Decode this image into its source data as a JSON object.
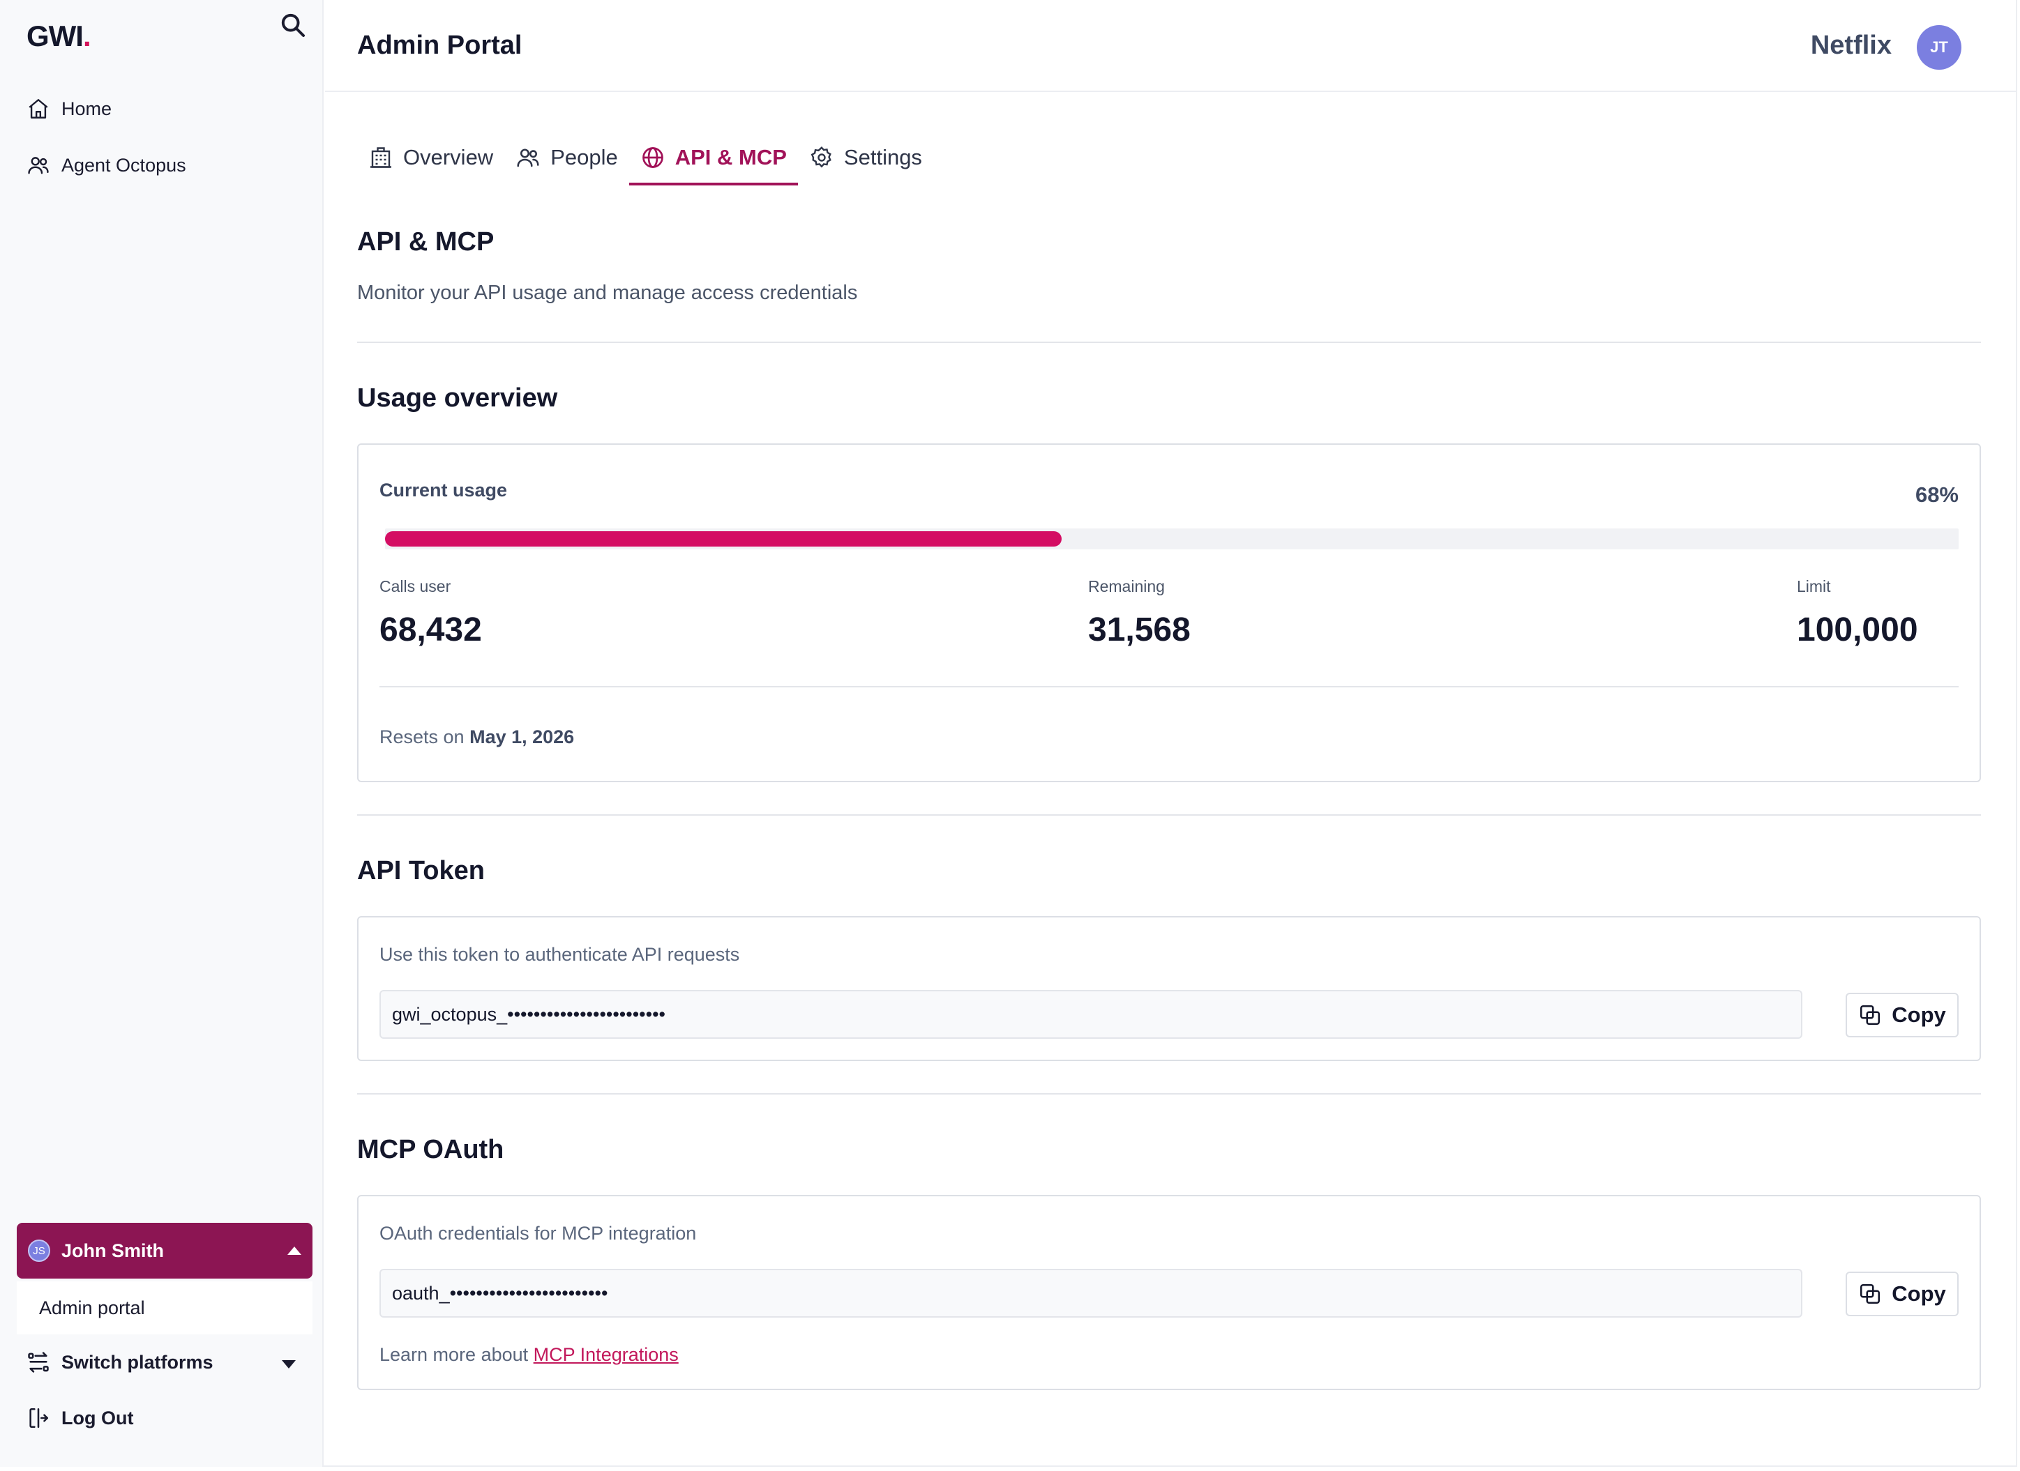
{
  "sidebar": {
    "logo_text": "GWI",
    "logo_dot": ".",
    "search_icon": "search-icon",
    "nav": [
      {
        "label": "Home",
        "icon": "home-icon"
      },
      {
        "label": "Agent Octopus",
        "icon": "users-icon"
      }
    ],
    "user": {
      "initials": "JS",
      "name": "John Smith"
    },
    "submenu_item": "Admin portal",
    "switch_platforms": "Switch platforms",
    "logout": "Log Out"
  },
  "header": {
    "title": "Admin Portal",
    "org": "Netflix",
    "avatar_initials": "JT"
  },
  "tabs": [
    {
      "label": "Overview",
      "icon": "building-icon",
      "active": false
    },
    {
      "label": "People",
      "icon": "people-icon",
      "active": false
    },
    {
      "label": "API & MCP",
      "icon": "globe-icon",
      "active": true
    },
    {
      "label": "Settings",
      "icon": "gear-icon",
      "active": false
    }
  ],
  "section": {
    "title": "API & MCP",
    "subtitle": "Monitor your API usage and manage access credentials"
  },
  "usage": {
    "heading": "Usage overview",
    "label": "Current usage",
    "percent_text": "68%",
    "percent_value": 0.43,
    "stats": [
      {
        "label": "Calls user",
        "value": "68,432"
      },
      {
        "label": "Remaining",
        "value": "31,568"
      },
      {
        "label": "Limit",
        "value": "100,000"
      }
    ],
    "resets_prefix": "Resets on",
    "resets_date": "May 1, 2026"
  },
  "api_token": {
    "heading": "API Token",
    "hint": "Use this token to authenticate API requests",
    "value": "gwi_octopus_••••••••••••••••••••••••",
    "copy_label": "Copy"
  },
  "mcp": {
    "heading": "MCP OAuth",
    "hint": "OAuth credentials for MCP integration",
    "value": "oauth_••••••••••••••••••••••••",
    "copy_label": "Copy",
    "learn_prefix": "Learn more about",
    "learn_link": "MCP Integrations"
  },
  "colors": {
    "accent": "#a11258",
    "progress": "#d40d63",
    "user_button": "#8c1553",
    "avatar": "#7b7fe0"
  }
}
